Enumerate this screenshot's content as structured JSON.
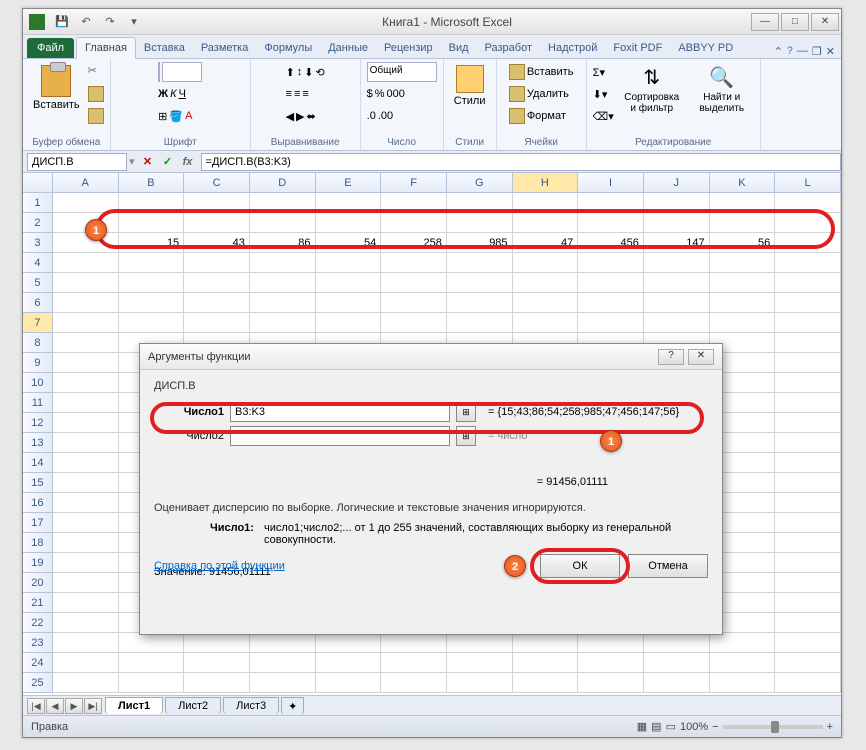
{
  "title": "Книга1 - Microsoft Excel",
  "tabs": {
    "file": "Файл",
    "home": "Главная",
    "insert": "Вставка",
    "layout": "Разметка",
    "formulas": "Формулы",
    "data": "Данные",
    "review": "Рецензир",
    "view": "Вид",
    "dev": "Разработ",
    "addins": "Надстрой",
    "foxit": "Foxit PDF",
    "abbyy": "ABBYY PD"
  },
  "ribbon_groups": {
    "clipboard": "Буфер обмена",
    "font": "Шрифт",
    "align": "Выравнивание",
    "number": "Число",
    "styles": "Стили",
    "cells": "Ячейки",
    "editing": "Редактирование"
  },
  "ribbon_btns": {
    "paste": "Вставить",
    "styles": "Стили",
    "insert": "Вставить",
    "delete": "Удалить",
    "format": "Формат",
    "sort": "Сортировка и фильтр",
    "find": "Найти и выделить",
    "general": "Общий"
  },
  "namebox": "ДИСП.В",
  "formula": "=ДИСП.В(B3:K3)",
  "columns": [
    "A",
    "B",
    "C",
    "D",
    "E",
    "F",
    "G",
    "H",
    "I",
    "J",
    "K",
    "L"
  ],
  "data_row": [
    "",
    "15",
    "43",
    "86",
    "54",
    "258",
    "985",
    "47",
    "456",
    "147",
    "56",
    ""
  ],
  "dialog": {
    "title": "Аргументы функции",
    "fn": "ДИСП.В",
    "arg1_label": "Число1",
    "arg1_value": "B3:K3",
    "arg1_result": "= {15;43;86;54;258;985;47;456;147;56}",
    "arg2_label": "Число2",
    "arg2_result": "= число",
    "result_label": "= 91456,01111",
    "desc": "Оценивает дисперсию по выборке. Логические и текстовые значения игнорируются.",
    "argdesc_lbl": "Число1:",
    "argdesc": "число1;число2;... от 1 до 255 значений, составляющих выборку из генеральной совокупности.",
    "value_label": "Значение:",
    "value": "91456,01111",
    "help": "Справка по этой функции",
    "ok": "ОК",
    "cancel": "Отмена"
  },
  "sheets": [
    "Лист1",
    "Лист2",
    "Лист3"
  ],
  "status": "Правка",
  "zoom": "100%"
}
